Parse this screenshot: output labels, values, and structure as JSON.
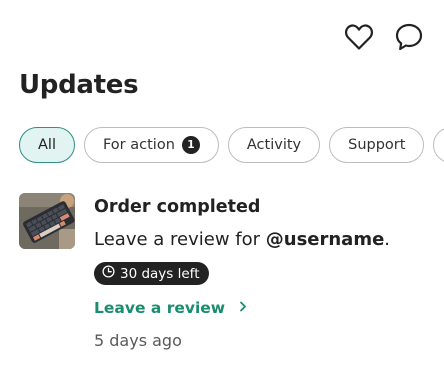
{
  "header": {
    "title": "Updates",
    "icons": [
      "heart-icon",
      "chat-bubble-icon"
    ]
  },
  "filters": [
    {
      "label": "All",
      "active": true
    },
    {
      "label": "For action",
      "count": "1",
      "active": false
    },
    {
      "label": "Activity",
      "active": false
    },
    {
      "label": "Support",
      "active": false
    }
  ],
  "update": {
    "title": "Order completed",
    "message_prefix": "Leave a review for ",
    "username": "@username",
    "message_suffix": ".",
    "deadline": "30 days left",
    "action_label": "Leave a review",
    "time": "5 days ago",
    "thumbnail": "keyboard-product-image"
  },
  "colors": {
    "accent": "#1a8c6f",
    "active_chip_bg": "#e2f4f2",
    "active_chip_border": "#2f8e87",
    "badge_bg": "#222222"
  }
}
